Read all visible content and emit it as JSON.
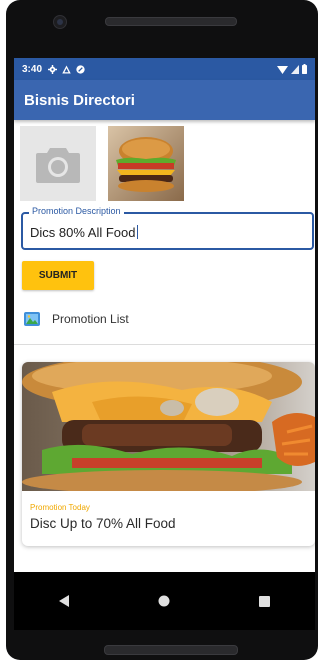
{
  "status_bar": {
    "time": "3:40"
  },
  "app_bar": {
    "title": "Bisnis Directori"
  },
  "form": {
    "description_label": "Promotion Description",
    "description_value": "Dics 80% All Food",
    "submit_label": "SUBMIT"
  },
  "promotion_list": {
    "label": "Promotion List"
  },
  "card": {
    "tag": "Promotion Today",
    "title": "Disc Up to 70% All Food"
  },
  "colors": {
    "status_bar": "#2b59a3",
    "app_bar": "#3a66b0",
    "accent": "#ffc20e",
    "card_tag": "#f0a800"
  },
  "icons": {
    "status": [
      "gear-icon",
      "alert-icon",
      "sync-icon",
      "wifi-icon",
      "signal-icon",
      "battery-icon"
    ],
    "nav": [
      "back-icon",
      "home-icon",
      "recents-icon"
    ]
  }
}
